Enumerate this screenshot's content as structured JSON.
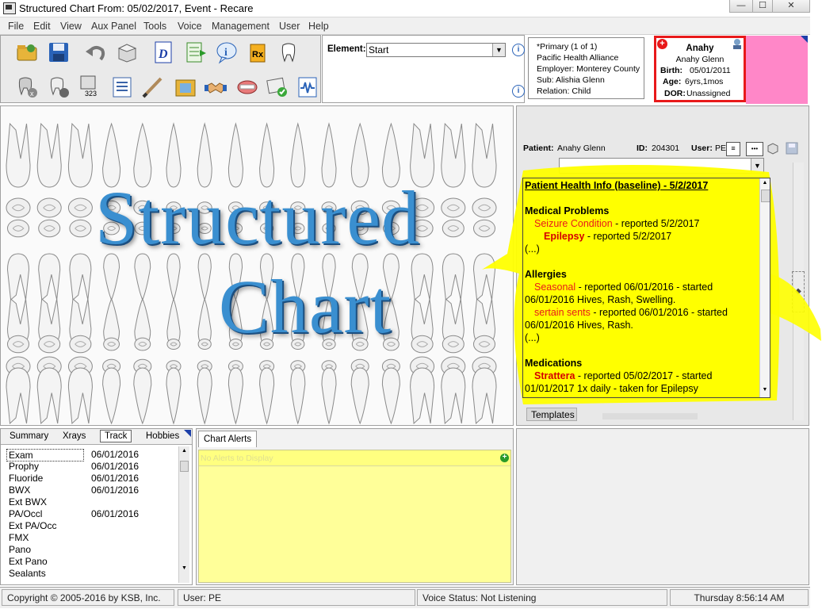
{
  "window": {
    "title": "Structured Chart From: 05/02/2017, Event - Recare",
    "min_label": "—",
    "max_label": "☐",
    "close_label": "✕"
  },
  "menu": [
    "File",
    "Edit",
    "View",
    "Aux Panel",
    "Tools",
    "Voice",
    "Management",
    "User",
    "Help"
  ],
  "toolbar": {
    "rx_label": "Rx",
    "num_label": "323"
  },
  "element": {
    "label": "Element:",
    "value": "Start"
  },
  "insurance": {
    "line1": "*Primary (1 of 1)",
    "line2": "Pacific Health Alliance",
    "line3": "Employer: Monterey County",
    "line4": "Sub: Alishia Glenn",
    "line5": "Relation: Child"
  },
  "patient_card": {
    "nickname": "Anahy",
    "full_name": "Anahy Glenn",
    "birth_label": "Birth:",
    "birth_value": "05/01/2011",
    "age_label": "Age:",
    "age_value": "6yrs,1mos",
    "dor_label": "DOR:",
    "dor_value": "Unassigned"
  },
  "chart_title": {
    "line1": "Structured",
    "line2": "Chart"
  },
  "right_panel": {
    "patient_label": "Patient:",
    "patient_value": "Anahy Glenn",
    "id_label": "ID:",
    "id_value": "204301",
    "user_label": "User:",
    "user_value": "PE",
    "templates_tab": "Templates"
  },
  "health_info": {
    "heading": "Patient Health Info (baseline) - 5/2/2017",
    "medical_heading": "Medical Problems",
    "med1_name": "Seizure Condition",
    "med1_rest": " - reported 5/2/2017",
    "med2_name": "Epilepsy",
    "med2_rest": " - reported 5/2/2017",
    "ellipsis1": "(...)",
    "allergies_heading": "Allergies",
    "al1_name": "Seasonal",
    "al1_rest": " - reported 06/01/2016 - started",
    "al1_line2": "06/01/2016 Hives, Rash, Swelling.",
    "al2_name": "sertain sents",
    "al2_rest": " - reported 06/01/2016 - started",
    "al2_line2": "06/01/2016 Hives, Rash.",
    "ellipsis2": "(...)",
    "medications_heading": "Medications",
    "md1_name": "Strattera",
    "md1_rest": " - reported 05/02/2017 - started",
    "md1_line2": "01/01/2017 1x daily - taken for Epilepsy"
  },
  "left_tabs": [
    "Summary",
    "Xrays",
    "Track",
    "Hobbies"
  ],
  "track_list": [
    {
      "name": "Exam",
      "date": "06/01/2016"
    },
    {
      "name": "Prophy",
      "date": "06/01/2016"
    },
    {
      "name": "Fluoride",
      "date": "06/01/2016"
    },
    {
      "name": "BWX",
      "date": "06/01/2016"
    },
    {
      "name": "Ext BWX",
      "date": ""
    },
    {
      "name": "PA/Occl",
      "date": "06/01/2016"
    },
    {
      "name": "Ext PA/Occ",
      "date": ""
    },
    {
      "name": "FMX",
      "date": ""
    },
    {
      "name": "Pano",
      "date": ""
    },
    {
      "name": "Ext Pano",
      "date": ""
    },
    {
      "name": "Sealants",
      "date": ""
    }
  ],
  "alerts": {
    "tab": "Chart Alerts",
    "empty": "No Alerts to Display"
  },
  "status": {
    "copyright": "Copyright © 2005-2016 by KSB, Inc.",
    "user": "User: PE",
    "voice": "Voice Status: Not Listening",
    "clock": "Thursday 8:56:14 AM"
  },
  "colors": {
    "accent_red": "#e8191a",
    "health_yellow": "#ffff00",
    "alert_yellow": "#ffff99",
    "pink": "#ff87c8",
    "chart_blue": "#3a8fd0"
  },
  "icons": [
    "open-folder-icon",
    "save-icon",
    "undo-icon",
    "box-icon",
    "document-d-icon",
    "export-sheet-icon",
    "info-icon",
    "rx-icon",
    "tooth-icon",
    "tooth-x-icon",
    "tooth-delete-icon",
    "tooth-number-icon",
    "list-icon",
    "pen-icon",
    "image-folder-icon",
    "handshake-icon",
    "dentures-icon",
    "certificate-icon",
    "waveform-icon"
  ]
}
